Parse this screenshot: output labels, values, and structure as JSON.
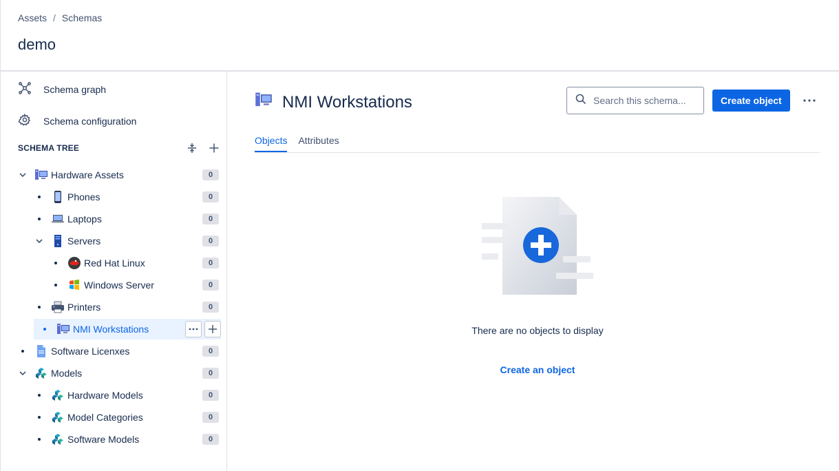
{
  "breadcrumb": {
    "items": [
      "Assets",
      "Schemas"
    ],
    "separator": "/"
  },
  "page": {
    "title": "demo"
  },
  "sidebar": {
    "links": [
      {
        "label": "Schema graph",
        "icon": "graph-icon"
      },
      {
        "label": "Schema configuration",
        "icon": "gear-icon"
      }
    ],
    "tree_title": "SCHEMA TREE",
    "tree": [
      {
        "label": "Hardware Assets",
        "count": "0",
        "level": 0,
        "expanded": true,
        "icon": "workstation-icon"
      },
      {
        "label": "Phones",
        "count": "0",
        "level": 1,
        "icon": "phone-icon"
      },
      {
        "label": "Laptops",
        "count": "0",
        "level": 1,
        "icon": "laptop-icon"
      },
      {
        "label": "Servers",
        "count": "0",
        "level": 1,
        "expanded": true,
        "icon": "server-icon"
      },
      {
        "label": "Red Hat Linux",
        "count": "0",
        "level": 2,
        "icon": "redhat-icon"
      },
      {
        "label": "Windows Server",
        "count": "0",
        "level": 2,
        "icon": "windows-icon"
      },
      {
        "label": "Printers",
        "count": "0",
        "level": 1,
        "icon": "printer-icon"
      },
      {
        "label": "NMI Workstations",
        "level": 1,
        "selected": true,
        "icon": "workstation-icon"
      },
      {
        "label": "Software Licenxes",
        "count": "0",
        "level": 0,
        "icon": "document-icon"
      },
      {
        "label": "Models",
        "count": "0",
        "level": 0,
        "expanded": true,
        "icon": "models-icon"
      },
      {
        "label": "Hardware Models",
        "count": "0",
        "level": 1,
        "icon": "models-icon"
      },
      {
        "label": "Model Categories",
        "count": "0",
        "level": 1,
        "icon": "models-icon"
      },
      {
        "label": "Software Models",
        "count": "0",
        "level": 1,
        "icon": "models-icon"
      }
    ]
  },
  "main": {
    "object_title": "NMI Workstations",
    "search_placeholder": "Search this schema...",
    "create_button": "Create object",
    "tabs": [
      {
        "label": "Objects",
        "active": true
      },
      {
        "label": "Attributes"
      }
    ],
    "empty_message": "There are no objects to display",
    "empty_action": "Create an object"
  },
  "colors": {
    "accent": "#0c66e4",
    "text": "#172b4d",
    "border": "#dfe1e6",
    "selected_bg": "#e9f2ff"
  }
}
